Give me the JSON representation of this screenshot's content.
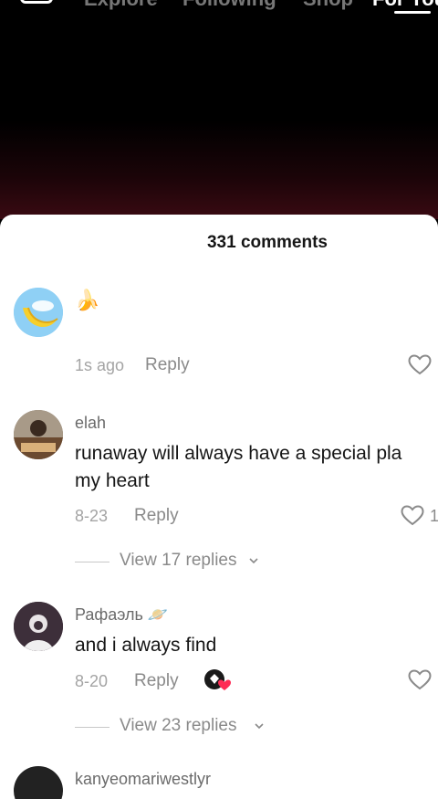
{
  "nav": {
    "tabs": [
      "Explore",
      "Following",
      "Shop",
      "For You"
    ],
    "active_tab": "For You"
  },
  "comments_sheet": {
    "title": "331 comments",
    "comments": [
      {
        "username": "",
        "text": "🍌",
        "time": "1s ago",
        "reply_label": "Reply",
        "likes": ""
      },
      {
        "username": "elah",
        "text_lines": [
          "runaway will always have a special pla",
          "my heart"
        ],
        "time": "8-23",
        "reply_label": "Reply",
        "likes": "1",
        "view_replies": "View 17 replies"
      },
      {
        "username": "Рафаэль 🪐",
        "text": "and i always find",
        "time": "8-20",
        "reply_label": "Reply",
        "likes": "",
        "view_replies": "View 23 replies"
      },
      {
        "username": "kanyeomariwestlyr",
        "text": ""
      }
    ]
  },
  "colors": {
    "sheet_bg": "#ffffff",
    "text_primary": "#161616",
    "text_secondary": "#8a8a8a",
    "accent_heart": "#fe2c55"
  },
  "icons": [
    "live-icon",
    "heart-outline-icon",
    "chevron-down-icon"
  ]
}
